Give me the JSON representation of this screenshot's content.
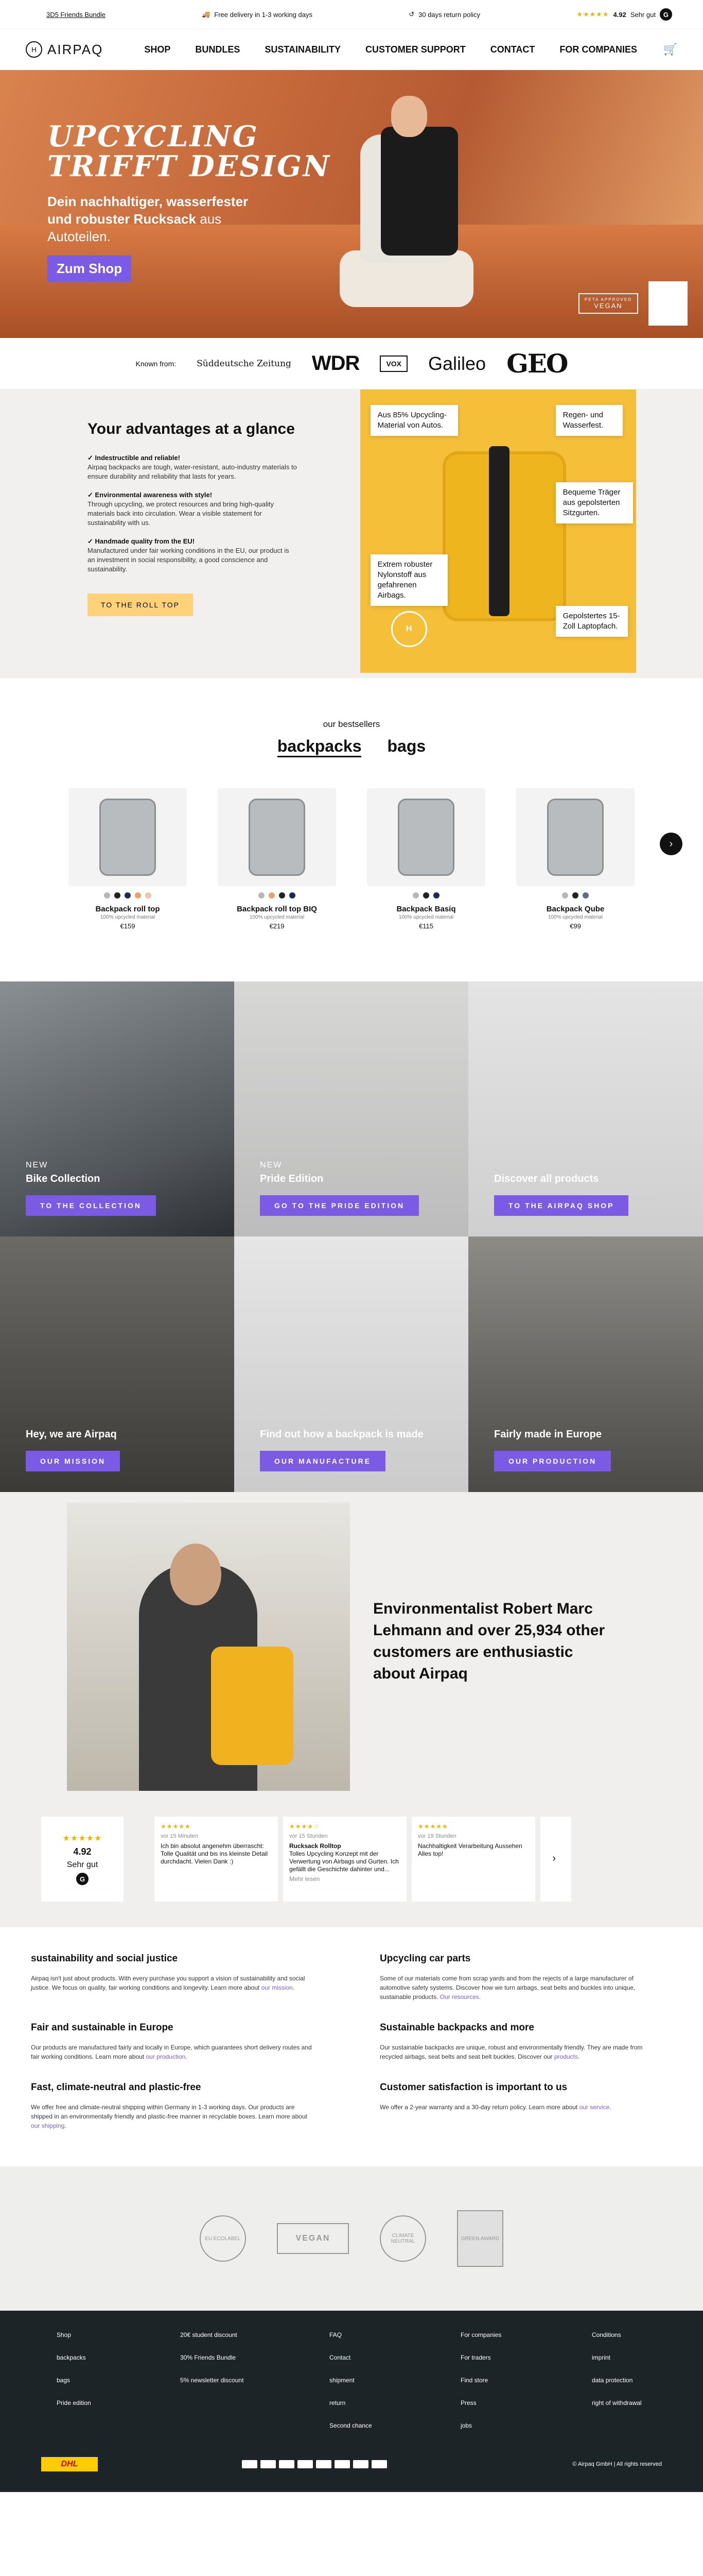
{
  "topbar": {
    "bundle_link": "3D5 Friends Bundle",
    "delivery": "Free delivery in 1-3 working days",
    "returns": "30 days return policy",
    "rating": "4.92",
    "rating_text": "Sehr gut",
    "google": "G"
  },
  "nav": {
    "logo": "AIRPAQ",
    "items": [
      "SHOP",
      "BUNDLES",
      "SUSTAINABILITY",
      "CUSTOMER SUPPORT",
      "CONTACT",
      "FOR COMPANIES"
    ]
  },
  "hero": {
    "title_line1": "UPCYCLING",
    "title_line2": "TRIFFT DESIGN",
    "subtitle_bold": "Dein nachhaltiger, wasserfester und robuster Rucksack",
    "subtitle_light": "aus Autoteilen.",
    "cta": "Zum Shop",
    "badge_vegan_top": "PETA APPROVED",
    "badge_vegan": "VEGAN"
  },
  "press": {
    "known_from": "Known from:",
    "logos": [
      "Süddeutsche Zeitung",
      "WDR",
      "VOX",
      "Galileo",
      "GEO"
    ]
  },
  "advantages": {
    "title": "Your advantages at a glance",
    "items": [
      {
        "title": "Indestructible and reliable!",
        "text": "Airpaq backpacks are tough, water-resistant, auto-industry materials to ensure durability and reliability that lasts for years."
      },
      {
        "title": "Environmental awareness with style!",
        "text": "Through upcycling, we protect resources and bring high-quality materials back into circulation. Wear a visible statement for sustainability with us."
      },
      {
        "title": "Handmade quality from the EU!",
        "text": "Manufactured under fair working conditions in the EU, our product is an investment in social responsibility, a good conscience and sustainability."
      }
    ],
    "button": "TO THE ROLL TOP",
    "callouts": [
      "Aus 85% Upcycling-Material von Autos.",
      "Regen- und Wasserfest.",
      "Bequeme Träger aus gepolsterten Sitzgurten.",
      "Extrem robuster Nylonstoff aus gefahrenen Airbags.",
      "Gepolstertes 15-Zoll Laptopfach."
    ],
    "image_logo": "AIRPAQ"
  },
  "bestsellers": {
    "label": "our bestsellers",
    "tabs": [
      "backpacks",
      "bags"
    ],
    "products": [
      {
        "name": "Backpack roll top",
        "meta": "100% upcycled material",
        "price": "€159",
        "swatches": [
          "#b7b7b7",
          "#222222",
          "#1d2a52",
          "#e7a26f",
          "#f2c4a3"
        ]
      },
      {
        "name": "Backpack roll top BIQ",
        "meta": "100% upcycled material",
        "price": "€219",
        "swatches": [
          "#b7b7b7",
          "#e7a26f",
          "#222222",
          "#1d2a52"
        ]
      },
      {
        "name": "Backpack Basiq",
        "meta": "100% upcycled material",
        "price": "€115",
        "swatches": [
          "#b7b7b7",
          "#222222",
          "#1d2a52"
        ]
      },
      {
        "name": "Backpack Qube",
        "meta": "100% upcycled material",
        "price": "€99",
        "swatches": [
          "#b7b7b7",
          "#222222",
          "#5b6b8a"
        ]
      }
    ]
  },
  "tiles": [
    {
      "tag": "NEW",
      "title": "Bike Collection",
      "button": "TO THE COLLECTION"
    },
    {
      "tag": "NEW",
      "title": "Pride Edition",
      "button": "GO TO THE PRIDE EDITION"
    },
    {
      "tag": "",
      "title": "Discover all products",
      "button": "TO THE AIRPAQ SHOP"
    },
    {
      "tag": "",
      "title": "Hey, we are Airpaq",
      "button": "OUR MISSION"
    },
    {
      "tag": "",
      "title": "Find out how a backpack is made",
      "button": "OUR MANUFACTURE"
    },
    {
      "tag": "",
      "title": "Fairly made in Europe",
      "button": "OUR PRODUCTION"
    }
  ],
  "ambassador": {
    "text": "Environmentalist Robert Marc Lehmann and over 25,934 other customers are enthusiastic about Airpaq"
  },
  "reviews": {
    "score": "4.92",
    "label": "Sehr gut",
    "cards": [
      {
        "time": "vor 15 Minuten",
        "text": "Ich bin absolut angenehm überrascht: Tolle Qualität und bis ins kleinste Detail durchdacht. Vielen Dank :)"
      },
      {
        "time": "vor 15 Stunden",
        "title": "Rucksack Rolltop",
        "text": "Tolles Upcycling Konzept mit der Verwertung von Airbags und Gurten. Ich gefällt die Geschichte dahinter und...",
        "more": "Mehr lesen"
      },
      {
        "time": "vor 19 Stunden",
        "text": "Nachhaltigkeit Verarbeitung Aussehen Alles top!"
      }
    ]
  },
  "seo": [
    {
      "title": "sustainability and social justice",
      "text": "Airpaq isn't just about products. With every purchase you support a vision of sustainability and social justice. We focus on quality, fair working conditions and longevity. Learn more about",
      "link": "our mission"
    },
    {
      "title": "Upcycling car parts",
      "text": "Some of our materials come from scrap yards and from the rejects of a large manufacturer of automotive safety systems. Discover how we turn airbags, seat belts and buckles into unique, sustainable products.",
      "link": "Our resources"
    },
    {
      "title": "Fair and sustainable in Europe",
      "text": "Our products are manufactured fairly and locally in Europe, which guarantees short delivery routes and fair working conditions. Learn more about",
      "link": "our production"
    },
    {
      "title": "Sustainable backpacks and more",
      "text": "Our sustainable backpacks are unique, robust and environmentally friendly. They are made from recycled airbags, seat belts and seat belt buckles. Discover our",
      "link": "products"
    },
    {
      "title": "Fast, climate-neutral and plastic-free",
      "text": "We offer free and climate-neutral shipping within Germany in 1-3 working days. Our products are shipped in an environmentally friendly and plastic-free manner in recyclable boxes. Learn more about",
      "link": "our shipping"
    },
    {
      "title": "Customer satisfaction is important to us",
      "text": "We offer a 2-year warranty and a 30-day return policy. Learn more about",
      "link": "our service"
    }
  ],
  "seals": [
    "EU ECOLABEL",
    "VEGAN",
    "CLIMATE NEUTRAL",
    "GREEN AWARD"
  ],
  "footer": {
    "cols": [
      [
        "Shop",
        "backpacks",
        "bags",
        "Pride edition"
      ],
      [
        "20€ student discount",
        "30% Friends Bundle",
        "5% newsletter discount"
      ],
      [
        "FAQ",
        "Contact",
        "shipment",
        "return",
        "Second chance"
      ],
      [
        "For companies",
        "For traders",
        "Find store",
        "Press",
        "jobs"
      ],
      [
        "Conditions",
        "imprint",
        "data protection",
        "right of withdrawal"
      ]
    ],
    "shipping": "DHL",
    "copyright": "© Airpaq GmbH | All rights reserved"
  }
}
